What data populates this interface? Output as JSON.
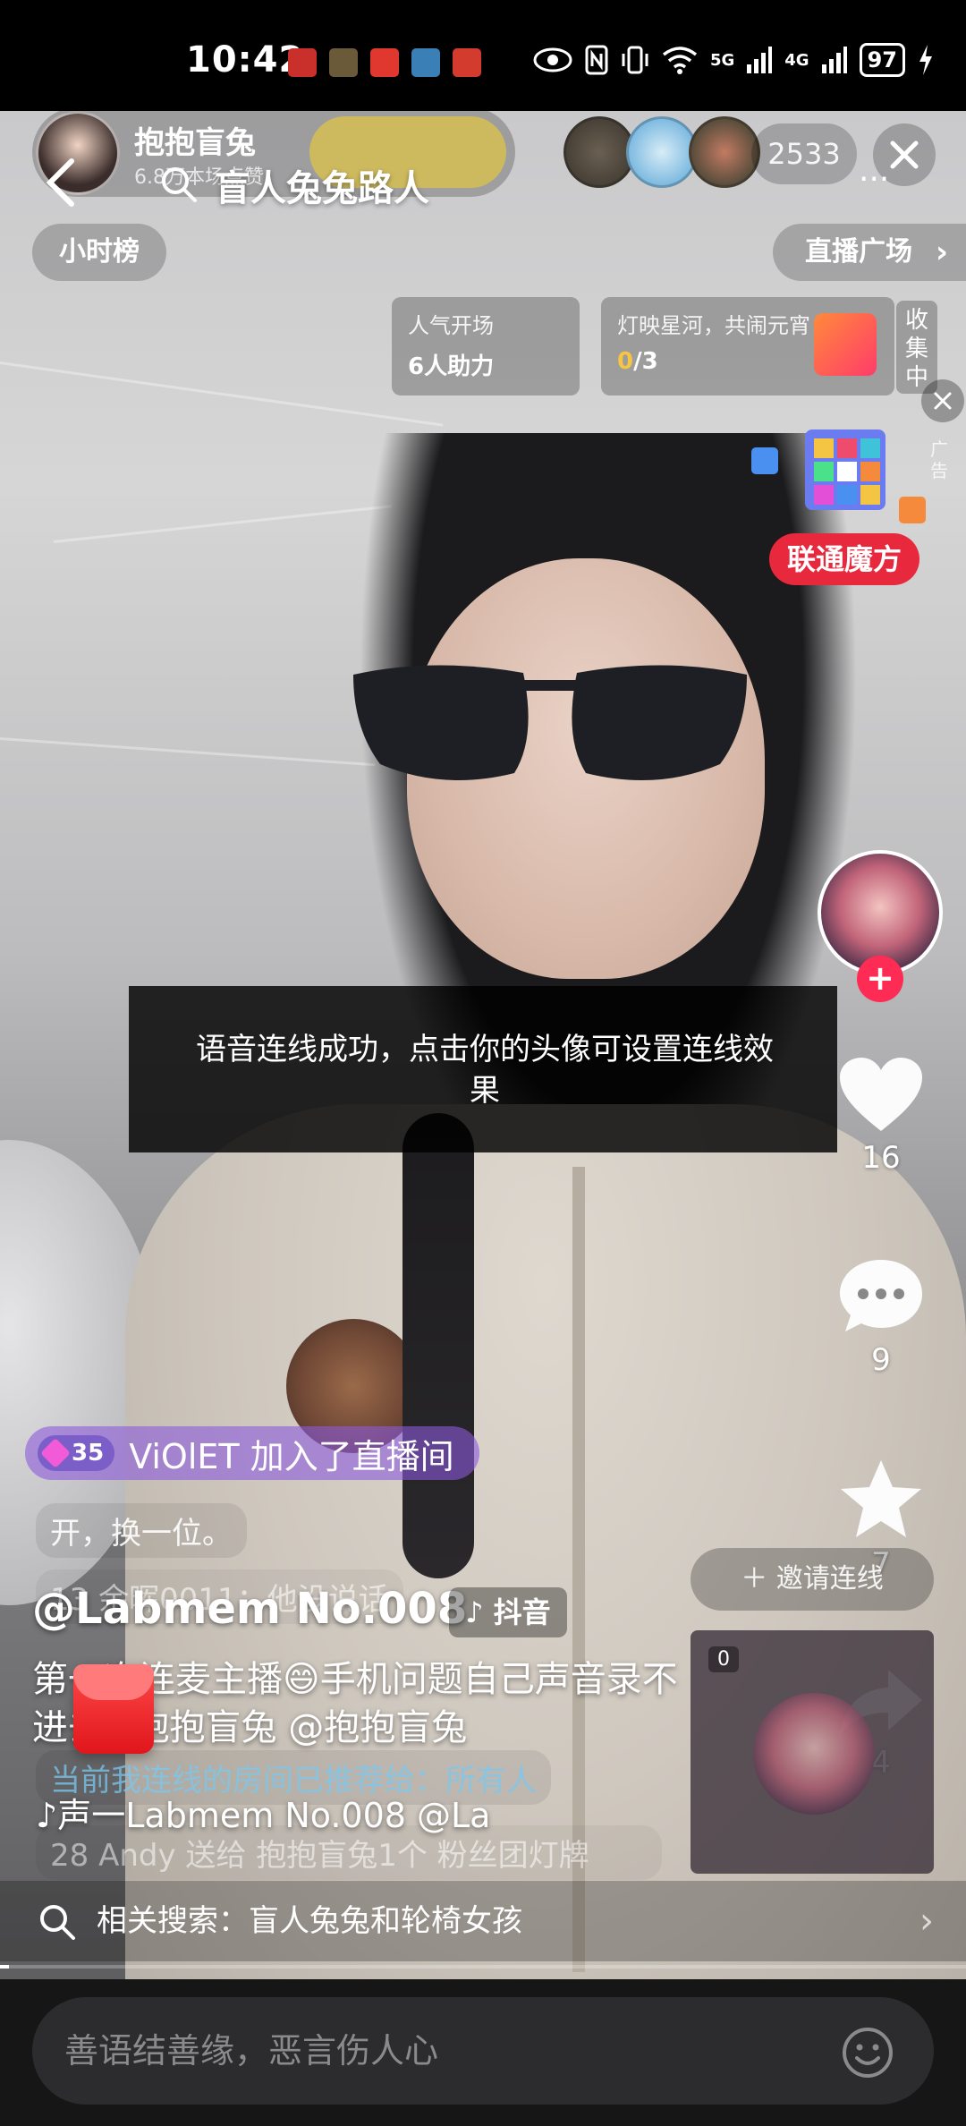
{
  "status": {
    "time": "10:42",
    "network1": "5G",
    "network2": "4G",
    "battery": "97"
  },
  "host": {
    "name": "抱抱盲兔",
    "likes": "6.8万本场点赞"
  },
  "search": {
    "query": "盲人兔兔路人"
  },
  "viewers": {
    "count": "2533"
  },
  "top_tabs": {
    "hour_rank": "小时榜",
    "live_plaza": "直播广场"
  },
  "tasks": [
    {
      "line1": "人气开场",
      "line2": "6人助力"
    },
    {
      "line1": "灯映星河，共闹元宵",
      "progress": "0",
      "total": "/3"
    }
  ],
  "collect_label": "收集中",
  "ad": {
    "label": "广告",
    "title": "联通魔方"
  },
  "toast": {
    "text": "语音连线成功，点击你的头像可设置连线效果"
  },
  "rail": {
    "likes": "16",
    "comments": "9",
    "favorites": "7",
    "shares": "4"
  },
  "chat": {
    "join_level": "35",
    "join_text": "ViOlET 加入了直播间",
    "line_a": "开，换一位。",
    "line_b": "13 余晖0011：他没说话",
    "line_c": "当前我连线的房间已推荐给：所有人",
    "line_d": "28 Andy 送给 抱抱盲兔1个 粉丝团灯牌"
  },
  "caption": {
    "author": "@Labmem No.008",
    "platform": "抖音",
    "text": "第一次连麦主播😄手机问题自己声音录不进去#抱抱盲兔 @抱抱盲兔",
    "music": "♪声一Labmem No.008    @La"
  },
  "invite": {
    "label": "邀请连线"
  },
  "mini": {
    "badge": "0"
  },
  "related": {
    "text": "相关搜索：盲人兔兔和轮椅女孩"
  },
  "input": {
    "placeholder": "善语结善缘，恶言伤人心"
  }
}
